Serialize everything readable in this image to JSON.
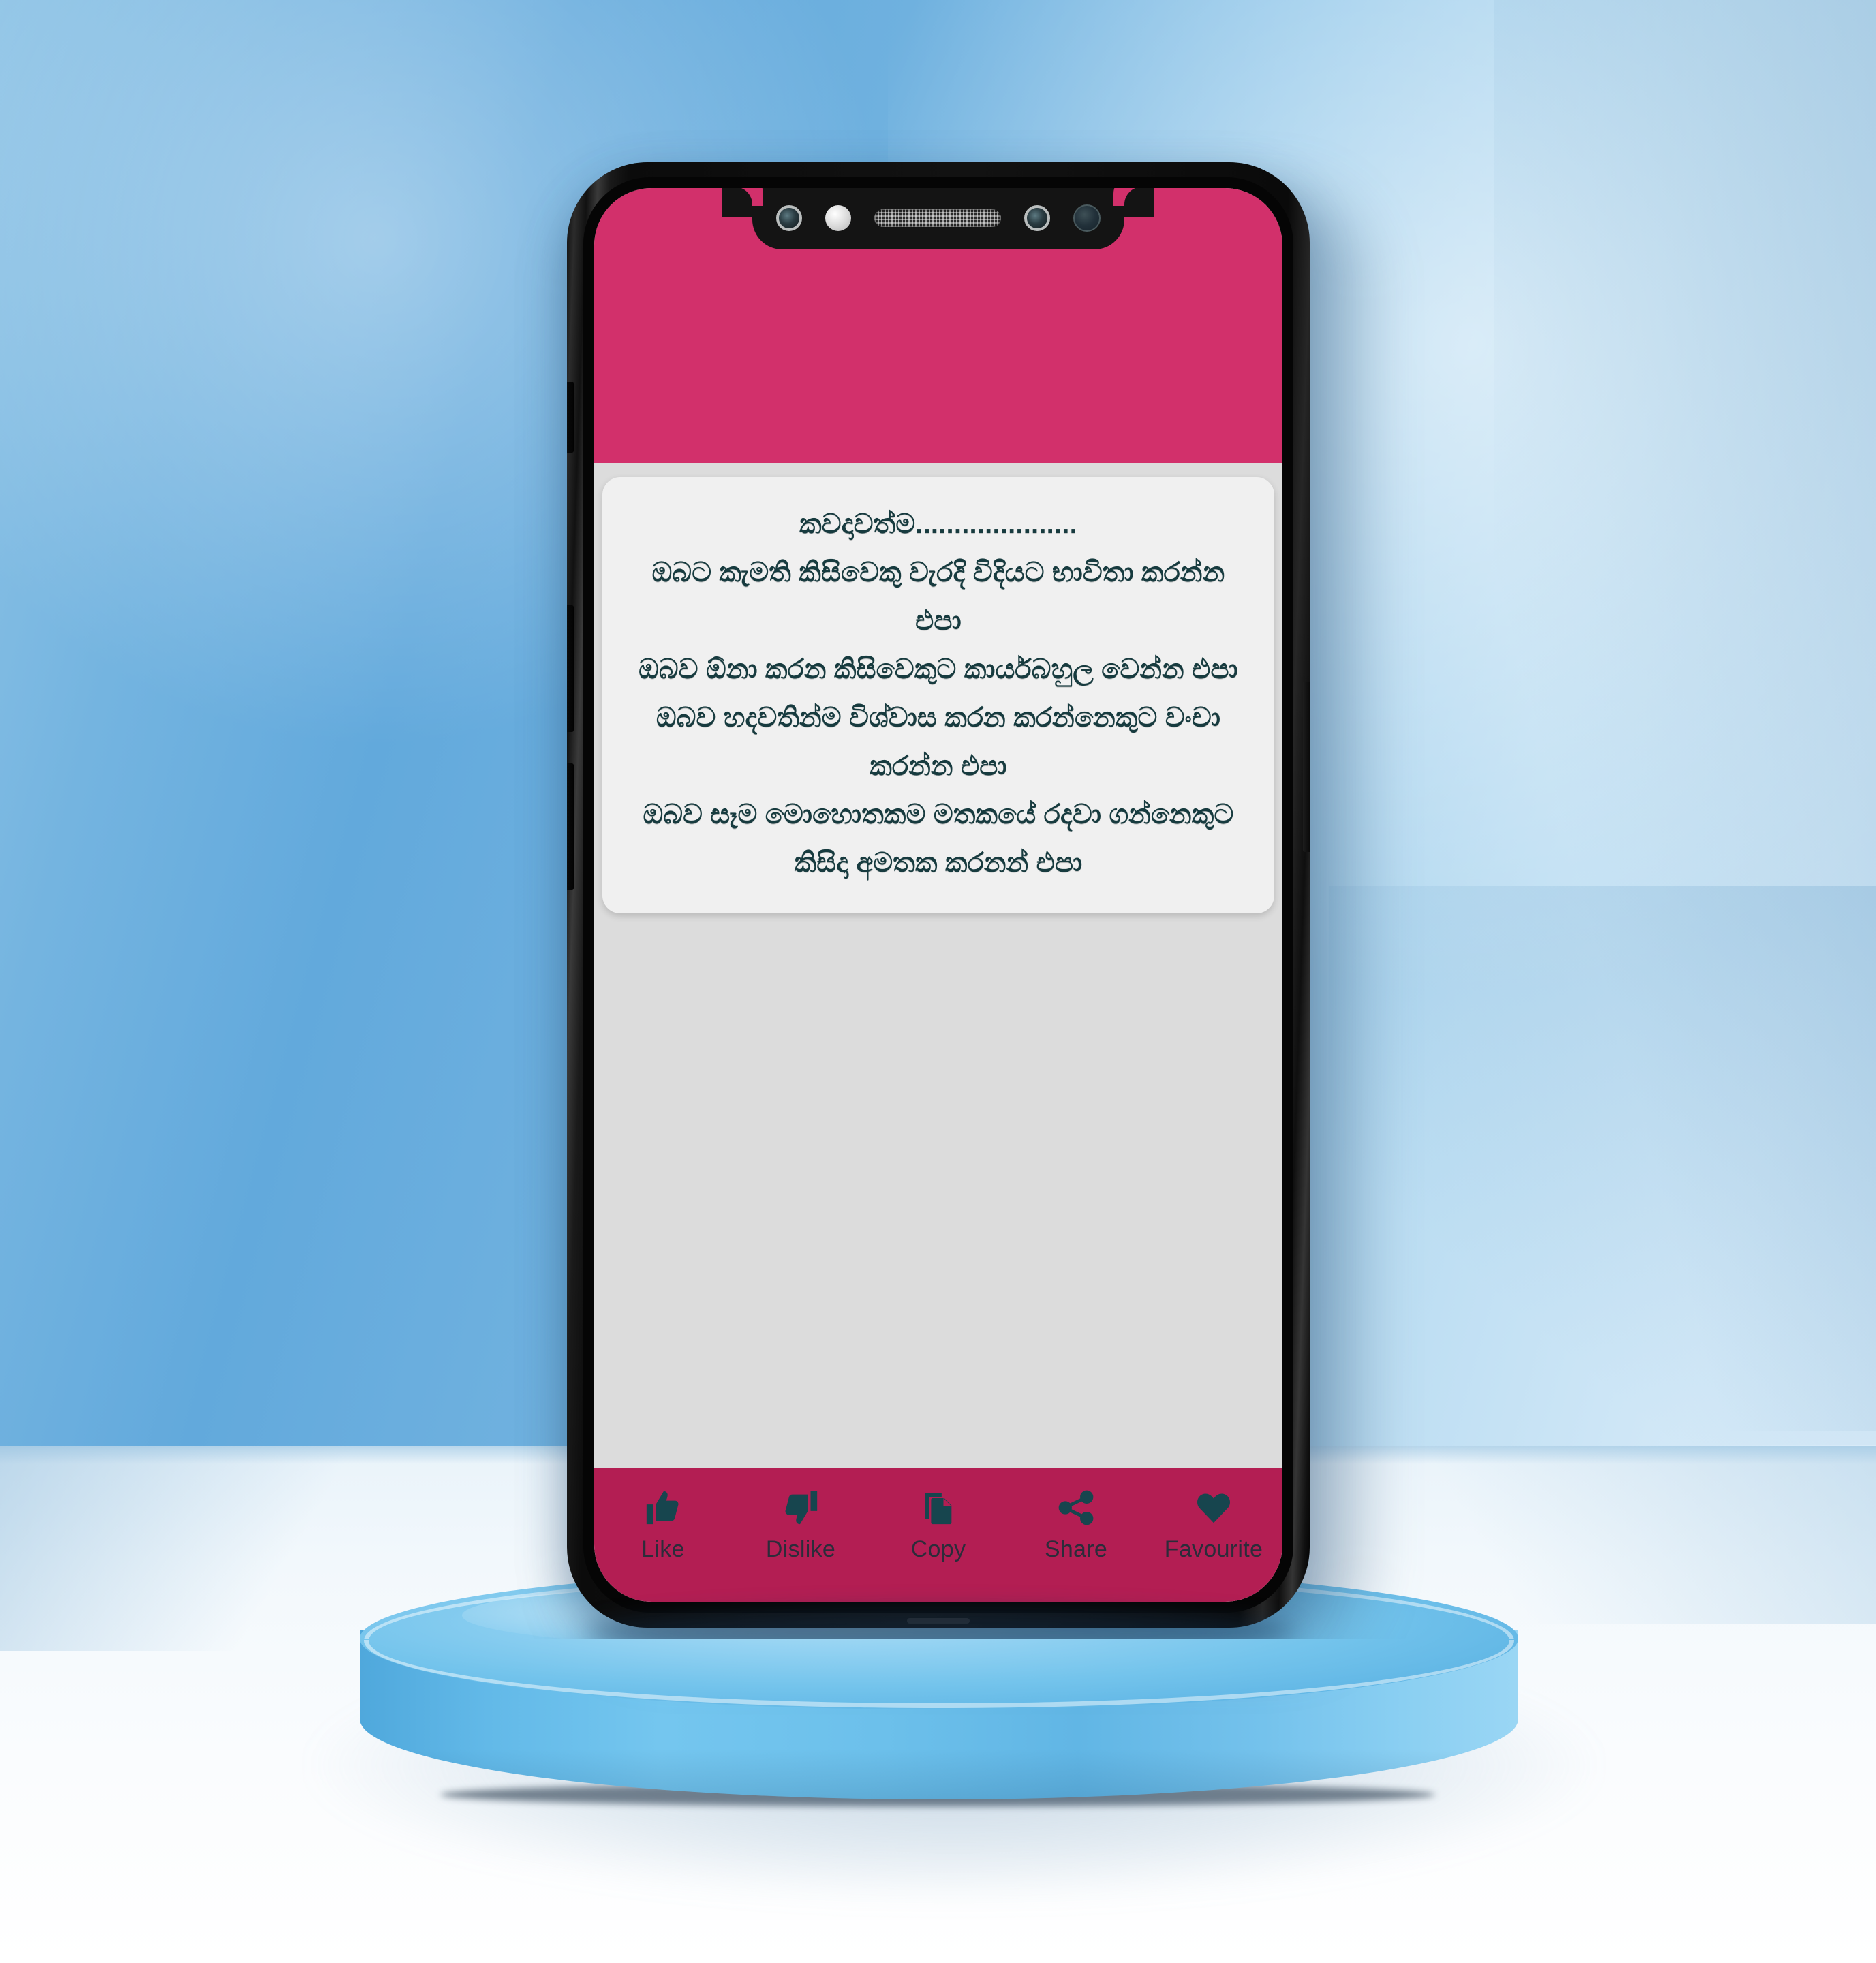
{
  "scene": {
    "background_color": "#6FB1DF",
    "floor_color": "#F6FAFD",
    "podium_color": "#6CC0EB"
  },
  "device": {
    "frame_color": "#101010",
    "notch": {
      "items": [
        {
          "name": "front-camera-lens",
          "type": "camera"
        },
        {
          "name": "light-sensor",
          "type": "sensor-light"
        },
        {
          "name": "earpiece-speaker",
          "type": "speaker"
        },
        {
          "name": "secondary-camera-lens",
          "type": "camera"
        },
        {
          "name": "proximity-sensor",
          "type": "sensor-dark"
        }
      ]
    },
    "side_buttons": [
      {
        "name": "silent-switch",
        "side": "left"
      },
      {
        "name": "volume-up-button",
        "side": "left"
      },
      {
        "name": "volume-down-button",
        "side": "left"
      },
      {
        "name": "power-button",
        "side": "right"
      }
    ]
  },
  "app": {
    "appbar_color": "#D2306B",
    "bottombar_color": "#B31E53",
    "screen_background": "#DCDCDC",
    "card_background": "#F0F0F0",
    "text_color": "#173B3F",
    "quote": {
      "lines": [
        "කවදාවත්ම.....................",
        "ඔබට කැමති කිසිවෙකු වැරදි විදියට භාවිතා කරන්න",
        "එපා",
        "ඔබව ඕනා කරන කිසිවෙකුට කාර්යබහුල වෙන්න එපා",
        "ඔබව හදවතින්ම විශ්වාස කරන කරන්නෙකුට වංචා",
        "කරන්න එපා",
        "ඔබව සෑම මොහොතකම මතකයේ රදවා ගන්නෙකුට",
        "කිසිදා අමතක කරනන් එපා"
      ]
    },
    "actions": [
      {
        "label": "Like",
        "icon": "thumbs-up-icon"
      },
      {
        "label": "Dislike",
        "icon": "thumbs-down-icon"
      },
      {
        "label": "Copy",
        "icon": "copy-icon"
      },
      {
        "label": "Share",
        "icon": "share-icon"
      },
      {
        "label": "Favourite",
        "icon": "heart-icon"
      }
    ]
  }
}
